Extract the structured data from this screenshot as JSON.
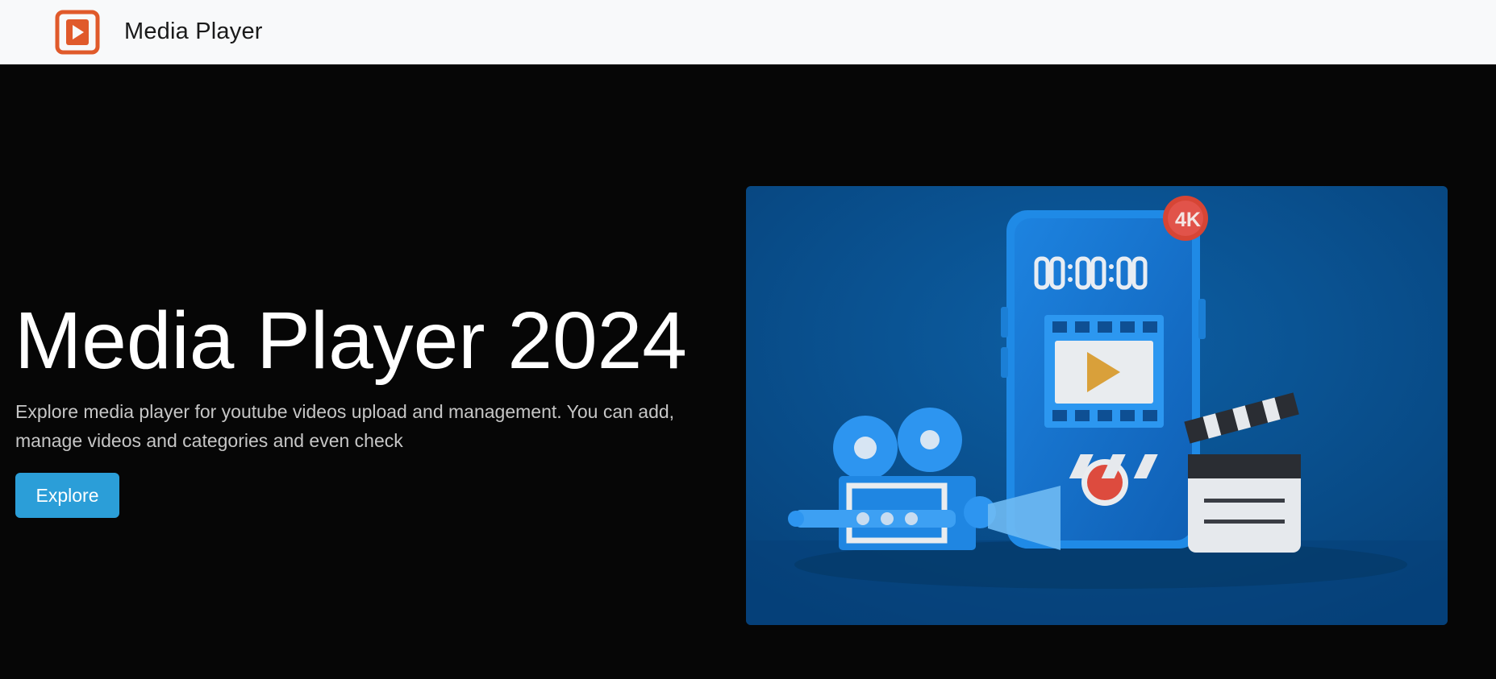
{
  "navbar": {
    "brand_name": "Media Player",
    "logo_icon": "play-square-icon",
    "logo_color": "#e05a2b"
  },
  "hero": {
    "title": "Media Player 2024",
    "description": "Explore media player for youtube videos upload and management. You can add, manage videos and categories and even check",
    "explore_label": "Explore",
    "accent_color": "#2b9ed8",
    "illustration": {
      "timer_text": "00:00:00",
      "badge_text": "4K"
    }
  }
}
